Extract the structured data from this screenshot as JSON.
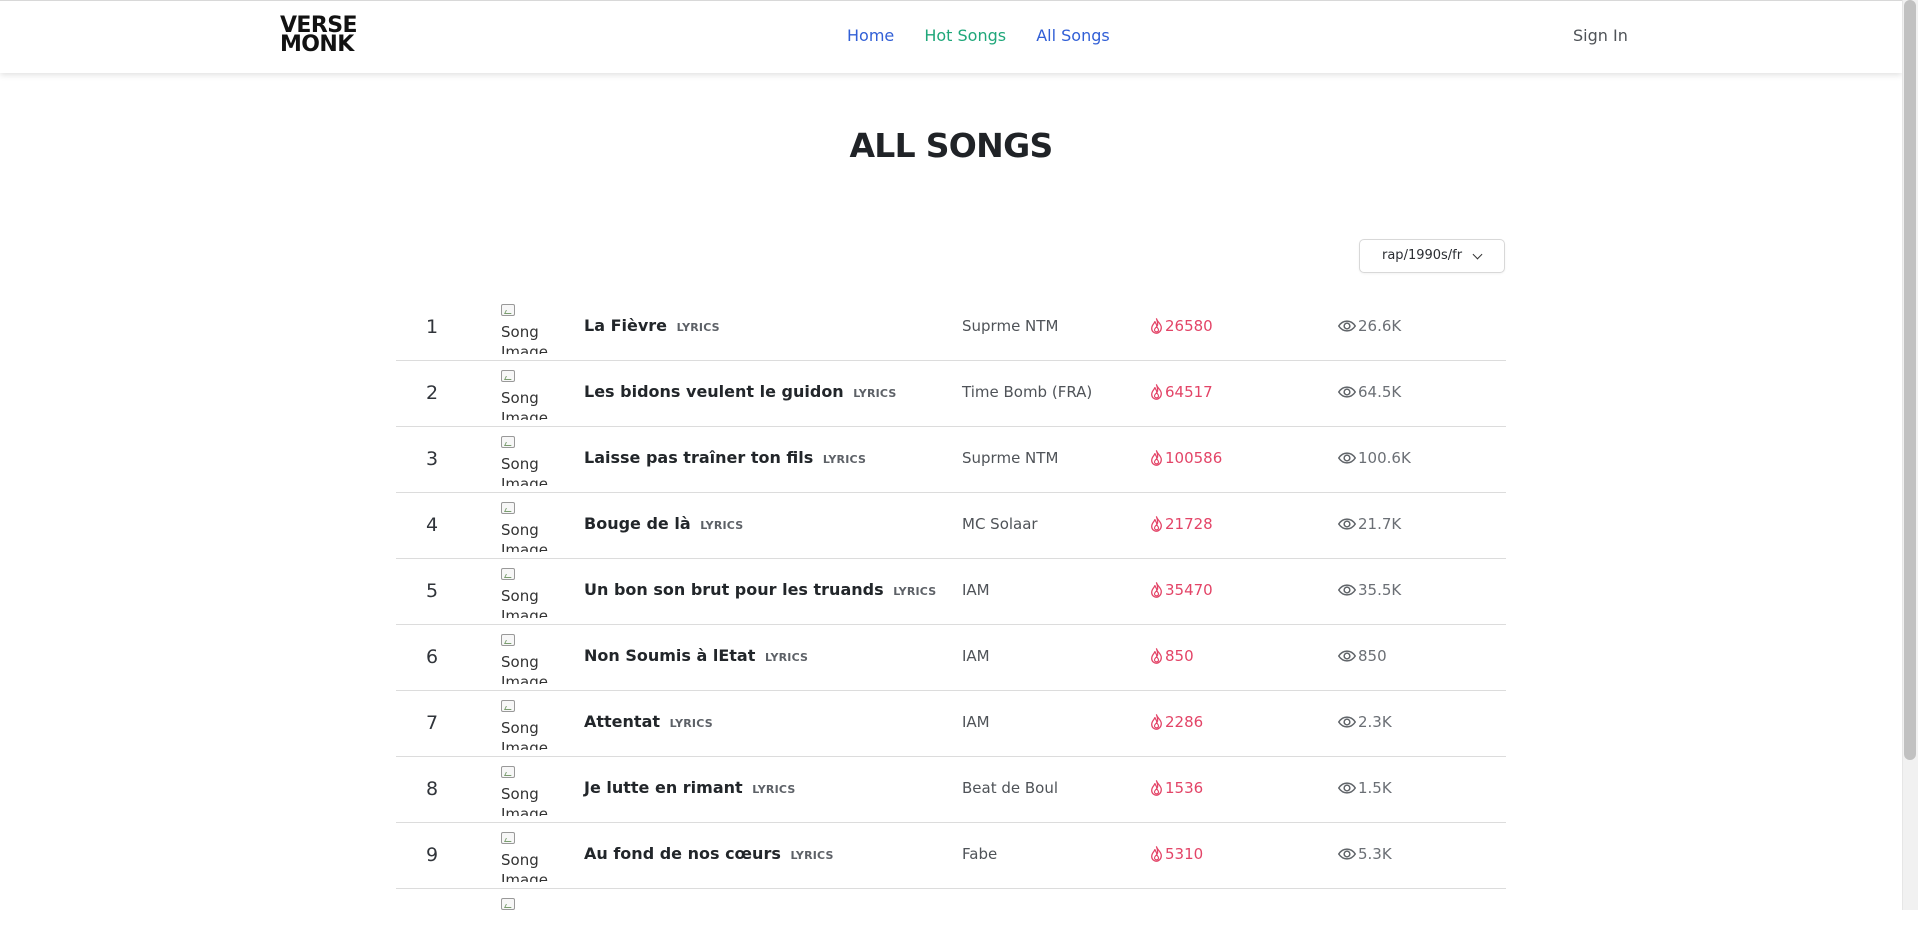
{
  "header": {
    "logo": [
      "VERSE",
      "MONK"
    ],
    "nav": [
      {
        "label": "Home",
        "state": "normal"
      },
      {
        "label": "Hot Songs",
        "state": "active"
      },
      {
        "label": "All Songs",
        "state": "normal"
      }
    ],
    "signin": "Sign In"
  },
  "page": {
    "title": "ALL SONGS",
    "filter": {
      "selected": "rap/1990s/fr"
    }
  },
  "songs": [
    {
      "rank": "1",
      "image_alt": "Song Image",
      "title": "La Fièvre",
      "lyrics_tag": "LYRICS",
      "artist": "Suprme NTM",
      "hotness": "26580",
      "views": "26.6K"
    },
    {
      "rank": "2",
      "image_alt": "Song Image",
      "title": "Les bidons veulent le guidon",
      "lyrics_tag": "LYRICS",
      "artist": "Time Bomb (FRA)",
      "hotness": "64517",
      "views": "64.5K"
    },
    {
      "rank": "3",
      "image_alt": "Song Image",
      "title": "Laisse pas traîner ton fils",
      "lyrics_tag": "LYRICS",
      "artist": "Suprme NTM",
      "hotness": "100586",
      "views": "100.6K"
    },
    {
      "rank": "4",
      "image_alt": "Song Image",
      "title": "Bouge de là",
      "lyrics_tag": "LYRICS",
      "artist": "MC Solaar",
      "hotness": "21728",
      "views": "21.7K"
    },
    {
      "rank": "5",
      "image_alt": "Song Image",
      "title": "Un bon son brut pour les truands",
      "lyrics_tag": "LYRICS",
      "artist": "IAM",
      "hotness": "35470",
      "views": "35.5K"
    },
    {
      "rank": "6",
      "image_alt": "Song Image",
      "title": "Non Soumis à lEtat",
      "lyrics_tag": "LYRICS",
      "artist": "IAM",
      "hotness": "850",
      "views": "850"
    },
    {
      "rank": "7",
      "image_alt": "Song Image",
      "title": "Attentat",
      "lyrics_tag": "LYRICS",
      "artist": "IAM",
      "hotness": "2286",
      "views": "2.3K"
    },
    {
      "rank": "8",
      "image_alt": "Song Image",
      "title": "Je lutte en rimant",
      "lyrics_tag": "LYRICS",
      "artist": "Beat de Boul",
      "hotness": "1536",
      "views": "1.5K"
    },
    {
      "rank": "9",
      "image_alt": "Song Image",
      "title": "Au fond de nos cœurs",
      "lyrics_tag": "LYRICS",
      "artist": "Fabe",
      "hotness": "5310",
      "views": "5.3K"
    }
  ],
  "colors": {
    "nav_link": "#315fd6",
    "nav_active": "#1fa77a",
    "hotness": "#e34467",
    "text": "#22262a"
  }
}
